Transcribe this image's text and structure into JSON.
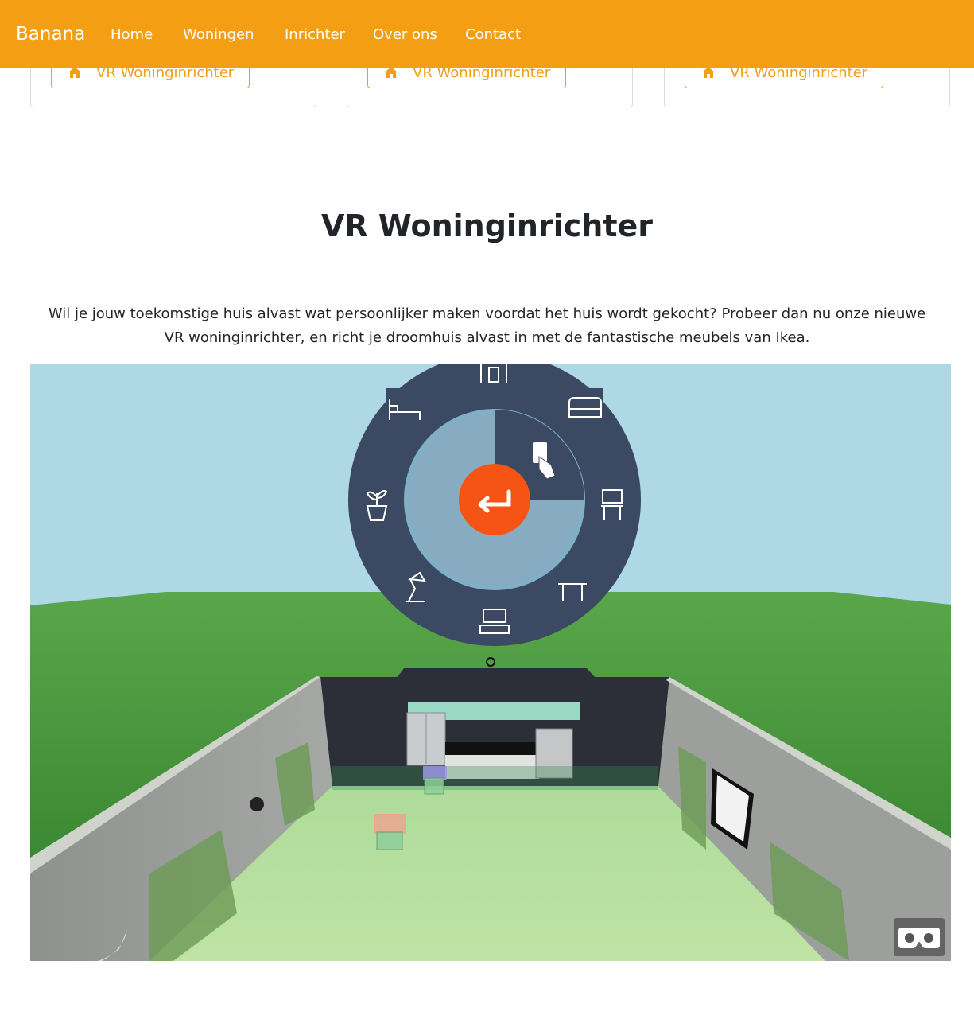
{
  "navbar": {
    "brand": "Banana",
    "links": [
      "Home",
      "Woningen",
      "Inrichter",
      "Over ons",
      "Contact"
    ]
  },
  "cards": [
    {
      "button_label": "VR Woninginrichter",
      "icon": "home-icon"
    },
    {
      "button_label": "VR Woninginrichter",
      "icon": "home-icon"
    },
    {
      "button_label": "VR Woninginrichter",
      "icon": "home-icon"
    }
  ],
  "section": {
    "title": "VR Woninginrichter",
    "intro": "Wil je jouw toekomstige huis alvast wat persoonlijker maken voordat het huis wordt gekocht? Probeer dan nu onze nieuwe VR woninginrichter, en richt je droomhuis alvast in met de fantastische meubels van Ikea."
  },
  "vr_menu": {
    "center_icon": "return-arrow-icon",
    "categories": [
      "cabinet-icon",
      "sofa-icon",
      "chair-icon",
      "table-icon",
      "tv-stand-icon",
      "lamp-icon",
      "plant-icon",
      "bed-icon"
    ],
    "selected": "hand-pointer-icon"
  },
  "vr_button_icon": "vr-headset-icon",
  "colors": {
    "navbar": "#f39e13",
    "menu_outer": "#3b4a62",
    "menu_inner": "#87acc1",
    "center_button": "#f55414"
  }
}
